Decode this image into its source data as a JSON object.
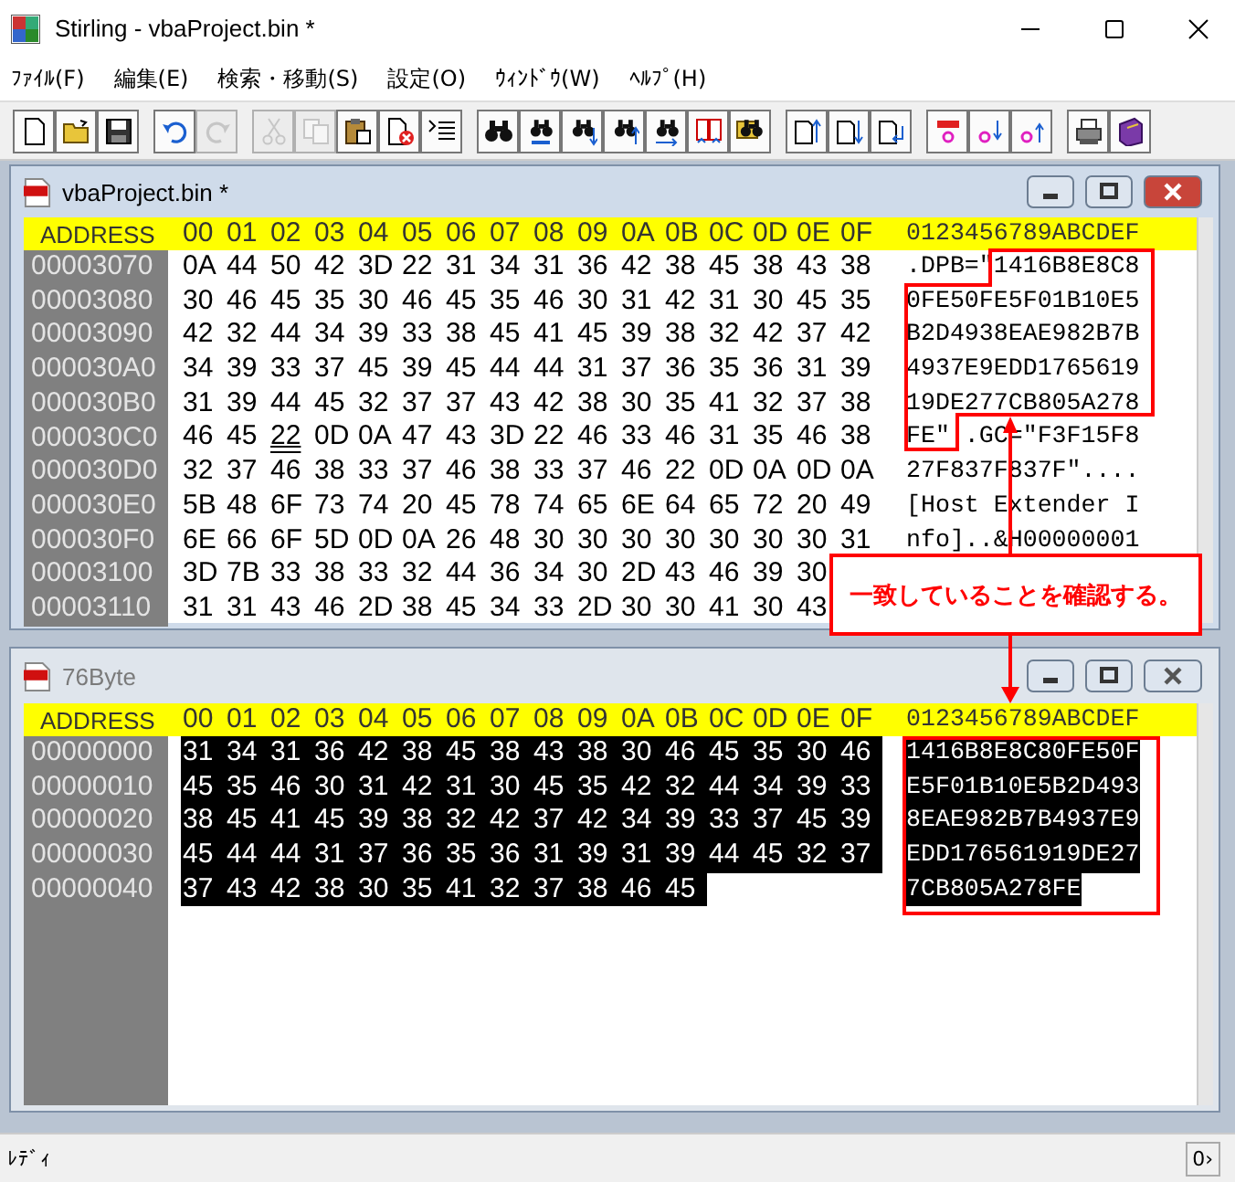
{
  "window": {
    "title": "Stirling - vbaProject.bin *"
  },
  "menu": [
    "ﾌｧｲﾙ(F)",
    "編集(E)",
    "検索・移動(S)",
    "設定(O)",
    "ｳｨﾝﾄﾞｳ(W)",
    "ﾍﾙﾌﾟ(H)"
  ],
  "toolbar": [
    [
      {
        "kind": "new",
        "disabled": false
      },
      {
        "kind": "open",
        "disabled": false
      },
      {
        "kind": "save",
        "disabled": false
      }
    ],
    [
      {
        "kind": "undo",
        "disabled": false
      },
      {
        "kind": "redo",
        "disabled": true
      }
    ],
    [
      {
        "kind": "cut",
        "disabled": true
      },
      {
        "kind": "copy",
        "disabled": true
      },
      {
        "kind": "paste",
        "disabled": false
      },
      {
        "kind": "delete",
        "disabled": false
      },
      {
        "kind": "list",
        "disabled": false
      }
    ],
    [
      {
        "kind": "find",
        "disabled": false
      },
      {
        "kind": "findtext",
        "disabled": false
      },
      {
        "kind": "finddown",
        "disabled": false
      },
      {
        "kind": "findup",
        "disabled": false
      },
      {
        "kind": "replace",
        "disabled": false
      },
      {
        "kind": "compare",
        "disabled": false
      },
      {
        "kind": "folderfind",
        "disabled": false
      }
    ],
    [
      {
        "kind": "pageup",
        "disabled": false
      },
      {
        "kind": "pagedown",
        "disabled": false
      },
      {
        "kind": "pagejump",
        "disabled": false
      }
    ],
    [
      {
        "kind": "mark",
        "disabled": false
      },
      {
        "kind": "markdown",
        "disabled": false
      },
      {
        "kind": "markup",
        "disabled": false
      }
    ],
    [
      {
        "kind": "print",
        "disabled": false
      },
      {
        "kind": "book",
        "disabled": false
      }
    ]
  ],
  "documents": [
    {
      "title": "vbaProject.bin *",
      "active": true,
      "header": {
        "address": "ADDRESS",
        "columns": [
          "00",
          "01",
          "02",
          "03",
          "04",
          "05",
          "06",
          "07",
          "08",
          "09",
          "0A",
          "0B",
          "0C",
          "0D",
          "0E",
          "0F"
        ],
        "ascii": "0123456789ABCDEF"
      },
      "rows": [
        {
          "address": "00003070",
          "selected": false,
          "ascii": ".DPB=\"1416B8E8C8",
          "bytes": [
            {
              "v": "0A",
              "cursor": false
            },
            {
              "v": "44",
              "cursor": false
            },
            {
              "v": "50",
              "cursor": false
            },
            {
              "v": "42",
              "cursor": false
            },
            {
              "v": "3D",
              "cursor": false
            },
            {
              "v": "22",
              "cursor": false
            },
            {
              "v": "31",
              "cursor": false
            },
            {
              "v": "34",
              "cursor": false
            },
            {
              "v": "31",
              "cursor": false
            },
            {
              "v": "36",
              "cursor": false
            },
            {
              "v": "42",
              "cursor": false
            },
            {
              "v": "38",
              "cursor": false
            },
            {
              "v": "45",
              "cursor": false
            },
            {
              "v": "38",
              "cursor": false
            },
            {
              "v": "43",
              "cursor": false
            },
            {
              "v": "38",
              "cursor": false
            }
          ]
        },
        {
          "address": "00003080",
          "selected": false,
          "ascii": "0FE50FE5F01B10E5",
          "bytes": [
            {
              "v": "30",
              "cursor": false
            },
            {
              "v": "46",
              "cursor": false
            },
            {
              "v": "45",
              "cursor": false
            },
            {
              "v": "35",
              "cursor": false
            },
            {
              "v": "30",
              "cursor": false
            },
            {
              "v": "46",
              "cursor": false
            },
            {
              "v": "45",
              "cursor": false
            },
            {
              "v": "35",
              "cursor": false
            },
            {
              "v": "46",
              "cursor": false
            },
            {
              "v": "30",
              "cursor": false
            },
            {
              "v": "31",
              "cursor": false
            },
            {
              "v": "42",
              "cursor": false
            },
            {
              "v": "31",
              "cursor": false
            },
            {
              "v": "30",
              "cursor": false
            },
            {
              "v": "45",
              "cursor": false
            },
            {
              "v": "35",
              "cursor": false
            }
          ]
        },
        {
          "address": "00003090",
          "selected": false,
          "ascii": "B2D4938EAE982B7B",
          "bytes": [
            {
              "v": "42",
              "cursor": false
            },
            {
              "v": "32",
              "cursor": false
            },
            {
              "v": "44",
              "cursor": false
            },
            {
              "v": "34",
              "cursor": false
            },
            {
              "v": "39",
              "cursor": false
            },
            {
              "v": "33",
              "cursor": false
            },
            {
              "v": "38",
              "cursor": false
            },
            {
              "v": "45",
              "cursor": false
            },
            {
              "v": "41",
              "cursor": false
            },
            {
              "v": "45",
              "cursor": false
            },
            {
              "v": "39",
              "cursor": false
            },
            {
              "v": "38",
              "cursor": false
            },
            {
              "v": "32",
              "cursor": false
            },
            {
              "v": "42",
              "cursor": false
            },
            {
              "v": "37",
              "cursor": false
            },
            {
              "v": "42",
              "cursor": false
            }
          ]
        },
        {
          "address": "000030A0",
          "selected": false,
          "ascii": "4937E9EDD1765619",
          "bytes": [
            {
              "v": "34",
              "cursor": false
            },
            {
              "v": "39",
              "cursor": false
            },
            {
              "v": "33",
              "cursor": false
            },
            {
              "v": "37",
              "cursor": false
            },
            {
              "v": "45",
              "cursor": false
            },
            {
              "v": "39",
              "cursor": false
            },
            {
              "v": "45",
              "cursor": false
            },
            {
              "v": "44",
              "cursor": false
            },
            {
              "v": "44",
              "cursor": false
            },
            {
              "v": "31",
              "cursor": false
            },
            {
              "v": "37",
              "cursor": false
            },
            {
              "v": "36",
              "cursor": false
            },
            {
              "v": "35",
              "cursor": false
            },
            {
              "v": "36",
              "cursor": false
            },
            {
              "v": "31",
              "cursor": false
            },
            {
              "v": "39",
              "cursor": false
            }
          ]
        },
        {
          "address": "000030B0",
          "selected": false,
          "ascii": "19DE277CB805A278",
          "bytes": [
            {
              "v": "31",
              "cursor": false
            },
            {
              "v": "39",
              "cursor": false
            },
            {
              "v": "44",
              "cursor": false
            },
            {
              "v": "45",
              "cursor": false
            },
            {
              "v": "32",
              "cursor": false
            },
            {
              "v": "37",
              "cursor": false
            },
            {
              "v": "37",
              "cursor": false
            },
            {
              "v": "43",
              "cursor": false
            },
            {
              "v": "42",
              "cursor": false
            },
            {
              "v": "38",
              "cursor": false
            },
            {
              "v": "30",
              "cursor": false
            },
            {
              "v": "35",
              "cursor": false
            },
            {
              "v": "41",
              "cursor": false
            },
            {
              "v": "32",
              "cursor": false
            },
            {
              "v": "37",
              "cursor": false
            },
            {
              "v": "38",
              "cursor": false
            }
          ]
        },
        {
          "address": "000030C0",
          "selected": false,
          "ascii": "FE\"..GC=\"F3F15F8",
          "bytes": [
            {
              "v": "46",
              "cursor": false
            },
            {
              "v": "45",
              "cursor": false
            },
            {
              "v": "22",
              "cursor": true
            },
            {
              "v": "0D",
              "cursor": false
            },
            {
              "v": "0A",
              "cursor": false
            },
            {
              "v": "47",
              "cursor": false
            },
            {
              "v": "43",
              "cursor": false
            },
            {
              "v": "3D",
              "cursor": false
            },
            {
              "v": "22",
              "cursor": false
            },
            {
              "v": "46",
              "cursor": false
            },
            {
              "v": "33",
              "cursor": false
            },
            {
              "v": "46",
              "cursor": false
            },
            {
              "v": "31",
              "cursor": false
            },
            {
              "v": "35",
              "cursor": false
            },
            {
              "v": "46",
              "cursor": false
            },
            {
              "v": "38",
              "cursor": false
            }
          ]
        },
        {
          "address": "000030D0",
          "selected": false,
          "ascii": "27F837F837F\"....",
          "bytes": [
            {
              "v": "32",
              "cursor": false
            },
            {
              "v": "37",
              "cursor": false
            },
            {
              "v": "46",
              "cursor": false
            },
            {
              "v": "38",
              "cursor": false
            },
            {
              "v": "33",
              "cursor": false
            },
            {
              "v": "37",
              "cursor": false
            },
            {
              "v": "46",
              "cursor": false
            },
            {
              "v": "38",
              "cursor": false
            },
            {
              "v": "33",
              "cursor": false
            },
            {
              "v": "37",
              "cursor": false
            },
            {
              "v": "46",
              "cursor": false
            },
            {
              "v": "22",
              "cursor": false
            },
            {
              "v": "0D",
              "cursor": false
            },
            {
              "v": "0A",
              "cursor": false
            },
            {
              "v": "0D",
              "cursor": false
            },
            {
              "v": "0A",
              "cursor": false
            }
          ]
        },
        {
          "address": "000030E0",
          "selected": false,
          "ascii": "[Host Extender I",
          "bytes": [
            {
              "v": "5B",
              "cursor": false
            },
            {
              "v": "48",
              "cursor": false
            },
            {
              "v": "6F",
              "cursor": false
            },
            {
              "v": "73",
              "cursor": false
            },
            {
              "v": "74",
              "cursor": false
            },
            {
              "v": "20",
              "cursor": false
            },
            {
              "v": "45",
              "cursor": false
            },
            {
              "v": "78",
              "cursor": false
            },
            {
              "v": "74",
              "cursor": false
            },
            {
              "v": "65",
              "cursor": false
            },
            {
              "v": "6E",
              "cursor": false
            },
            {
              "v": "64",
              "cursor": false
            },
            {
              "v": "65",
              "cursor": false
            },
            {
              "v": "72",
              "cursor": false
            },
            {
              "v": "20",
              "cursor": false
            },
            {
              "v": "49",
              "cursor": false
            }
          ]
        },
        {
          "address": "000030F0",
          "selected": false,
          "ascii": "nfo]..&H00000001",
          "bytes": [
            {
              "v": "6E",
              "cursor": false
            },
            {
              "v": "66",
              "cursor": false
            },
            {
              "v": "6F",
              "cursor": false
            },
            {
              "v": "5D",
              "cursor": false
            },
            {
              "v": "0D",
              "cursor": false
            },
            {
              "v": "0A",
              "cursor": false
            },
            {
              "v": "26",
              "cursor": false
            },
            {
              "v": "48",
              "cursor": false
            },
            {
              "v": "30",
              "cursor": false
            },
            {
              "v": "30",
              "cursor": false
            },
            {
              "v": "30",
              "cursor": false
            },
            {
              "v": "30",
              "cursor": false
            },
            {
              "v": "30",
              "cursor": false
            },
            {
              "v": "30",
              "cursor": false
            },
            {
              "v": "30",
              "cursor": false
            },
            {
              "v": "31",
              "cursor": false
            }
          ]
        },
        {
          "address": "00003100",
          "selected": false,
          "bytes": [
            {
              "v": "3D",
              "cursor": false
            },
            {
              "v": "7B",
              "cursor": false
            },
            {
              "v": "33",
              "cursor": false
            },
            {
              "v": "38",
              "cursor": false
            },
            {
              "v": "33",
              "cursor": false
            },
            {
              "v": "32",
              "cursor": false
            },
            {
              "v": "44",
              "cursor": false
            },
            {
              "v": "36",
              "cursor": false
            },
            {
              "v": "34",
              "cursor": false
            },
            {
              "v": "30",
              "cursor": false
            },
            {
              "v": "2D",
              "cursor": false
            },
            {
              "v": "43",
              "cursor": false
            },
            {
              "v": "46",
              "cursor": false
            },
            {
              "v": "39",
              "cursor": false
            },
            {
              "v": "30",
              "cursor": false
            }
          ]
        },
        {
          "address": "00003110",
          "selected": false,
          "bytes": [
            {
              "v": "31",
              "cursor": false
            },
            {
              "v": "31",
              "cursor": false
            },
            {
              "v": "43",
              "cursor": false
            },
            {
              "v": "46",
              "cursor": false
            },
            {
              "v": "2D",
              "cursor": false
            },
            {
              "v": "38",
              "cursor": false
            },
            {
              "v": "45",
              "cursor": false
            },
            {
              "v": "34",
              "cursor": false
            },
            {
              "v": "33",
              "cursor": false
            },
            {
              "v": "2D",
              "cursor": false
            },
            {
              "v": "30",
              "cursor": false
            },
            {
              "v": "30",
              "cursor": false
            },
            {
              "v": "41",
              "cursor": false
            },
            {
              "v": "30",
              "cursor": false
            },
            {
              "v": "43",
              "cursor": false
            }
          ]
        }
      ]
    },
    {
      "title": "76Byte",
      "active": false,
      "header": {
        "address": "ADDRESS",
        "columns": [
          "00",
          "01",
          "02",
          "03",
          "04",
          "05",
          "06",
          "07",
          "08",
          "09",
          "0A",
          "0B",
          "0C",
          "0D",
          "0E",
          "0F"
        ],
        "ascii": "0123456789ABCDEF"
      },
      "rows": [
        {
          "address": "00000000",
          "selected": true,
          "ascii": "1416B8E8C80FE50F",
          "bytes": [
            {
              "v": "31",
              "cursor": false
            },
            {
              "v": "34",
              "cursor": false
            },
            {
              "v": "31",
              "cursor": false
            },
            {
              "v": "36",
              "cursor": false
            },
            {
              "v": "42",
              "cursor": false
            },
            {
              "v": "38",
              "cursor": false
            },
            {
              "v": "45",
              "cursor": false
            },
            {
              "v": "38",
              "cursor": false
            },
            {
              "v": "43",
              "cursor": false
            },
            {
              "v": "38",
              "cursor": false
            },
            {
              "v": "30",
              "cursor": false
            },
            {
              "v": "46",
              "cursor": false
            },
            {
              "v": "45",
              "cursor": false
            },
            {
              "v": "35",
              "cursor": false
            },
            {
              "v": "30",
              "cursor": false
            },
            {
              "v": "46",
              "cursor": false
            }
          ]
        },
        {
          "address": "00000010",
          "selected": true,
          "ascii": "E5F01B10E5B2D493",
          "bytes": [
            {
              "v": "45",
              "cursor": false
            },
            {
              "v": "35",
              "cursor": false
            },
            {
              "v": "46",
              "cursor": false
            },
            {
              "v": "30",
              "cursor": false
            },
            {
              "v": "31",
              "cursor": false
            },
            {
              "v": "42",
              "cursor": false
            },
            {
              "v": "31",
              "cursor": false
            },
            {
              "v": "30",
              "cursor": false
            },
            {
              "v": "45",
              "cursor": false
            },
            {
              "v": "35",
              "cursor": false
            },
            {
              "v": "42",
              "cursor": false
            },
            {
              "v": "32",
              "cursor": false
            },
            {
              "v": "44",
              "cursor": false
            },
            {
              "v": "34",
              "cursor": false
            },
            {
              "v": "39",
              "cursor": false
            },
            {
              "v": "33",
              "cursor": false
            }
          ]
        },
        {
          "address": "00000020",
          "selected": true,
          "ascii": "8EAE982B7B4937E9",
          "bytes": [
            {
              "v": "38",
              "cursor": false
            },
            {
              "v": "45",
              "cursor": false
            },
            {
              "v": "41",
              "cursor": false
            },
            {
              "v": "45",
              "cursor": false
            },
            {
              "v": "39",
              "cursor": false
            },
            {
              "v": "38",
              "cursor": false
            },
            {
              "v": "32",
              "cursor": false
            },
            {
              "v": "42",
              "cursor": false
            },
            {
              "v": "37",
              "cursor": false
            },
            {
              "v": "42",
              "cursor": false
            },
            {
              "v": "34",
              "cursor": false
            },
            {
              "v": "39",
              "cursor": false
            },
            {
              "v": "33",
              "cursor": false
            },
            {
              "v": "37",
              "cursor": false
            },
            {
              "v": "45",
              "cursor": false
            },
            {
              "v": "39",
              "cursor": false
            }
          ]
        },
        {
          "address": "00000030",
          "selected": true,
          "ascii": "EDD176561919DE27",
          "bytes": [
            {
              "v": "45",
              "cursor": false
            },
            {
              "v": "44",
              "cursor": false
            },
            {
              "v": "44",
              "cursor": false
            },
            {
              "v": "31",
              "cursor": false
            },
            {
              "v": "37",
              "cursor": false
            },
            {
              "v": "36",
              "cursor": false
            },
            {
              "v": "35",
              "cursor": false
            },
            {
              "v": "36",
              "cursor": false
            },
            {
              "v": "31",
              "cursor": false
            },
            {
              "v": "39",
              "cursor": false
            },
            {
              "v": "31",
              "cursor": false
            },
            {
              "v": "39",
              "cursor": false
            },
            {
              "v": "44",
              "cursor": false
            },
            {
              "v": "45",
              "cursor": false
            },
            {
              "v": "32",
              "cursor": false
            },
            {
              "v": "37",
              "cursor": false
            }
          ]
        },
        {
          "address": "00000040",
          "selected": true,
          "ascii": "7CB805A278FE",
          "bytes": [
            {
              "v": "37",
              "cursor": false
            },
            {
              "v": "43",
              "cursor": false
            },
            {
              "v": "42",
              "cursor": false
            },
            {
              "v": "38",
              "cursor": false
            },
            {
              "v": "30",
              "cursor": false
            },
            {
              "v": "35",
              "cursor": false
            },
            {
              "v": "41",
              "cursor": false
            },
            {
              "v": "32",
              "cursor": false
            },
            {
              "v": "37",
              "cursor": false
            },
            {
              "v": "38",
              "cursor": false
            },
            {
              "v": "46",
              "cursor": false
            },
            {
              "v": "45",
              "cursor": false
            }
          ]
        }
      ]
    }
  ],
  "callout": {
    "text": "一致していることを確認する。"
  },
  "status_bar": {
    "text": "ﾚﾃﾞｨ",
    "indicator": "0›"
  }
}
